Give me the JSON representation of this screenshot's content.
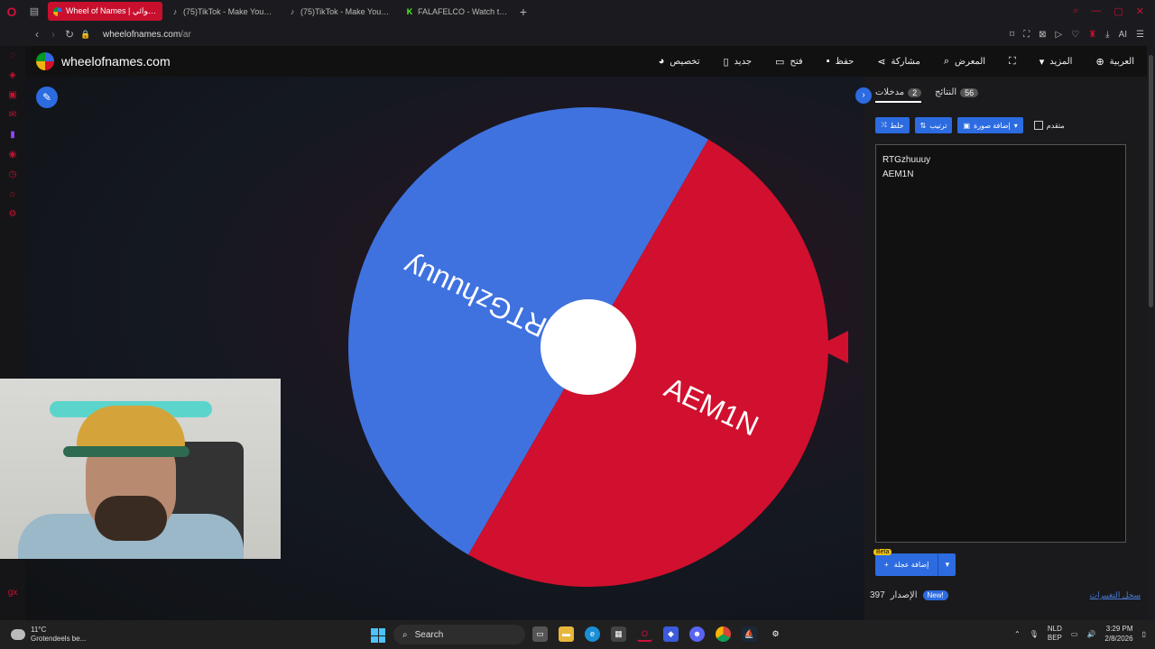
{
  "browser": {
    "tabs": [
      {
        "label": "Wheel of Names | العشوائي",
        "active": true
      },
      {
        "label": "(75)TikTok - Make Your Da",
        "active": false
      },
      {
        "label": "(75)TikTok - Make Your Da",
        "active": false
      },
      {
        "label": "FALAFELCO - Watch the Vi",
        "active": false
      }
    ],
    "url_host": "wheelofnames.com",
    "url_path": "/ar",
    "ai_label": "AI"
  },
  "app": {
    "brand": "wheelofnames.com",
    "menu": [
      "العربية",
      "المزيد",
      "المعرض",
      "مشاركة",
      "حفظ",
      "فتح",
      "جديد",
      "تخصيص"
    ]
  },
  "wheel": {
    "segments": [
      {
        "name": "RTGzhuuuy",
        "color": "#3f72df"
      },
      {
        "name": "AEM1N",
        "color": "#d0102e"
      }
    ],
    "hub_color": "#ffffff"
  },
  "panel": {
    "tabs": {
      "entries_label": "مدخلات",
      "entries_count": "2",
      "results_label": "النتائج",
      "results_count": "56"
    },
    "toolbar": {
      "shuffle": "خلط",
      "sort": "ترتيب",
      "add_image": "إضافة صورة",
      "advanced": "متقدم"
    },
    "entries": [
      "RTGzhuuuy",
      "AEM1N"
    ],
    "add_wheel": "إضافة عجلة",
    "beta": "Beta",
    "version_label": "الإصدار",
    "version": "397",
    "new_badge": "New!",
    "changelog": "سجل التغييرات"
  },
  "taskbar": {
    "weather_temp": "11°C",
    "weather_desc": "Grotendeels be...",
    "search_placeholder": "Search",
    "lang_top": "NLD",
    "lang_bottom": "BEP",
    "time": "3:29 PM",
    "date": "2/8/2026"
  }
}
